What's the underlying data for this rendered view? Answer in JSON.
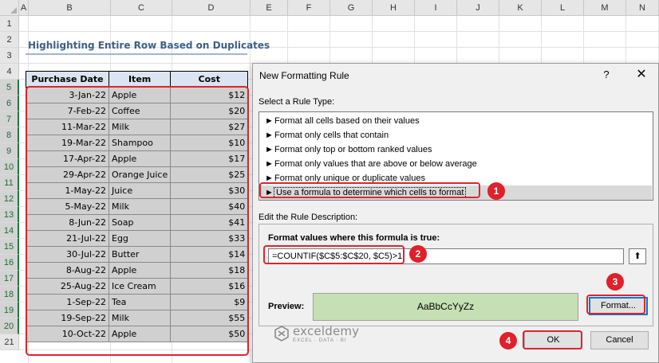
{
  "sheet": {
    "columns": [
      "A",
      "B",
      "C",
      "D",
      "E",
      "F",
      "G",
      "H",
      "I",
      "J",
      "K",
      "L",
      "M",
      "N"
    ],
    "rows": [
      "1",
      "2",
      "3",
      "4",
      "5",
      "6",
      "7",
      "8",
      "9",
      "10",
      "11",
      "12",
      "13",
      "14",
      "15",
      "16",
      "17",
      "18",
      "19",
      "20",
      "21"
    ],
    "title": "Highlighting Entire Row Based on Duplicates",
    "headers": [
      "Purchase Date",
      "Item",
      "Cost"
    ],
    "data": [
      [
        "3-Jan-22",
        "Apple",
        "$12"
      ],
      [
        "7-Feb-22",
        "Coffee",
        "$20"
      ],
      [
        "11-Mar-22",
        "Milk",
        "$27"
      ],
      [
        "19-Mar-22",
        "Shampoo",
        "$10"
      ],
      [
        "17-Apr-22",
        "Apple",
        "$17"
      ],
      [
        "29-Apr-22",
        "Orange Juice",
        "$25"
      ],
      [
        "1-May-22",
        "Juice",
        "$30"
      ],
      [
        "5-May-22",
        "Milk",
        "$40"
      ],
      [
        "8-Jun-22",
        "Soap",
        "$41"
      ],
      [
        "21-Jul-22",
        "Egg",
        "$33"
      ],
      [
        "30-Jul-22",
        "Butter",
        "$14"
      ],
      [
        "8-Aug-22",
        "Apple",
        "$18"
      ],
      [
        "25-Aug-22",
        "Ice Cream",
        "$16"
      ],
      [
        "1-Sep-22",
        "Tea",
        "$9"
      ],
      [
        "19-Sep-22",
        "Milk",
        "$55"
      ],
      [
        "10-Oct-22",
        "Apple",
        "$50"
      ]
    ]
  },
  "dialog": {
    "title": "New Formatting Rule",
    "help": "?",
    "close": "✕",
    "select_label": "Select a Rule Type:",
    "rule_arrow": "►",
    "rule_types": [
      "Format all cells based on their values",
      "Format only cells that contain",
      "Format only top or bottom ranked values",
      "Format only values that are above or below average",
      "Format only unique or duplicate values",
      "Use a formula to determine which cells to format"
    ],
    "edit_label": "Edit the Rule Description:",
    "formula_label": "Format values where this formula is true:",
    "formula": "=COUNTIF($C$5:$C$20, $C5)>1",
    "collapse_icon": "⬆",
    "preview_label": "Preview:",
    "preview_text": "AaBbCcYyZz",
    "format_button": "Format...",
    "ok_button": "OK",
    "cancel_button": "Cancel"
  },
  "steps": [
    "1",
    "2",
    "3",
    "4"
  ],
  "watermark": {
    "name": "exceldemy",
    "tagline": "EXCEL · DATA · BI"
  },
  "colors": {
    "highlight": "#d9262f",
    "preview_fill": "#c6e0b4",
    "selected_cells": "#d0d0d0",
    "header_fill": "#dbe5f1"
  }
}
